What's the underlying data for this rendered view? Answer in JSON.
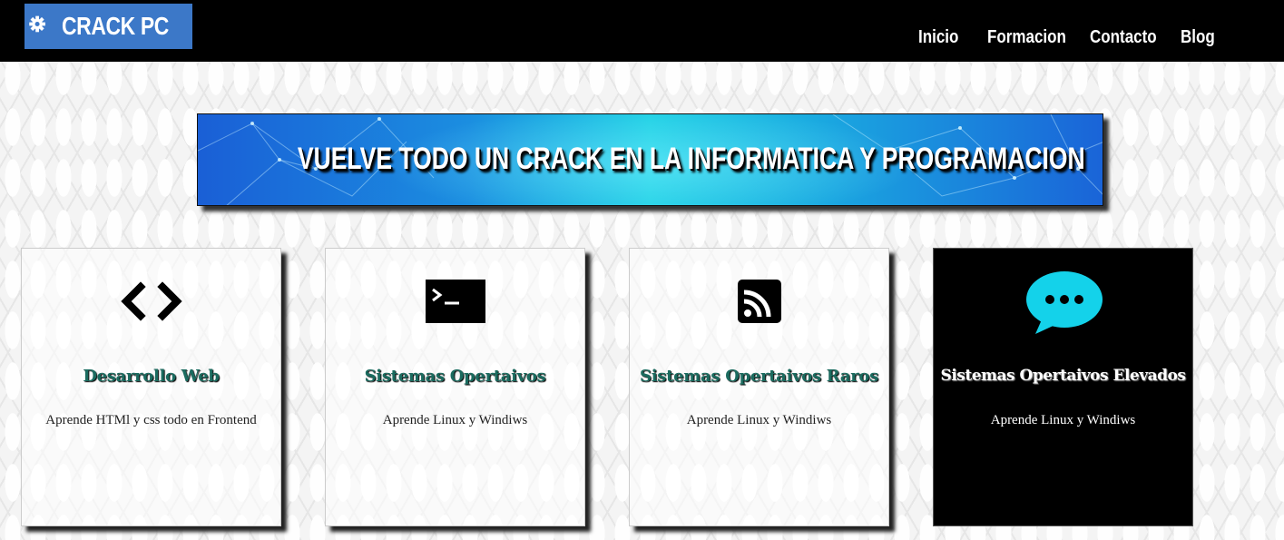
{
  "header": {
    "logo_text": "CRACK PC",
    "logo_color": "#3c78c8",
    "nav": [
      {
        "label": "Inicio"
      },
      {
        "label": "Formacion"
      },
      {
        "label": "Contacto"
      },
      {
        "label": "Blog"
      }
    ]
  },
  "banner": {
    "text": "VUELVE TODO UN CRACK EN LA INFORMATICA Y PROGRAMACION"
  },
  "cards": [
    {
      "icon": "code-icon",
      "title": "Desarrollo Web",
      "description": "Aprende HTMl y css todo en Frontend"
    },
    {
      "icon": "terminal-icon",
      "title": "Sistemas Opertaivos",
      "description": "Aprende Linux y Windiws"
    },
    {
      "icon": "rss-icon",
      "title": "Sistemas Opertaivos Raros",
      "description": "Aprende Linux y Windiws"
    },
    {
      "icon": "chat-bubble-icon",
      "title": "Sistemas Opertaivos Elevados",
      "description": "Aprende Linux y Windiws"
    }
  ],
  "colors": {
    "topbar": "#000000",
    "card_title": "#1b6b5f",
    "chat_icon": "#14d2ea"
  }
}
